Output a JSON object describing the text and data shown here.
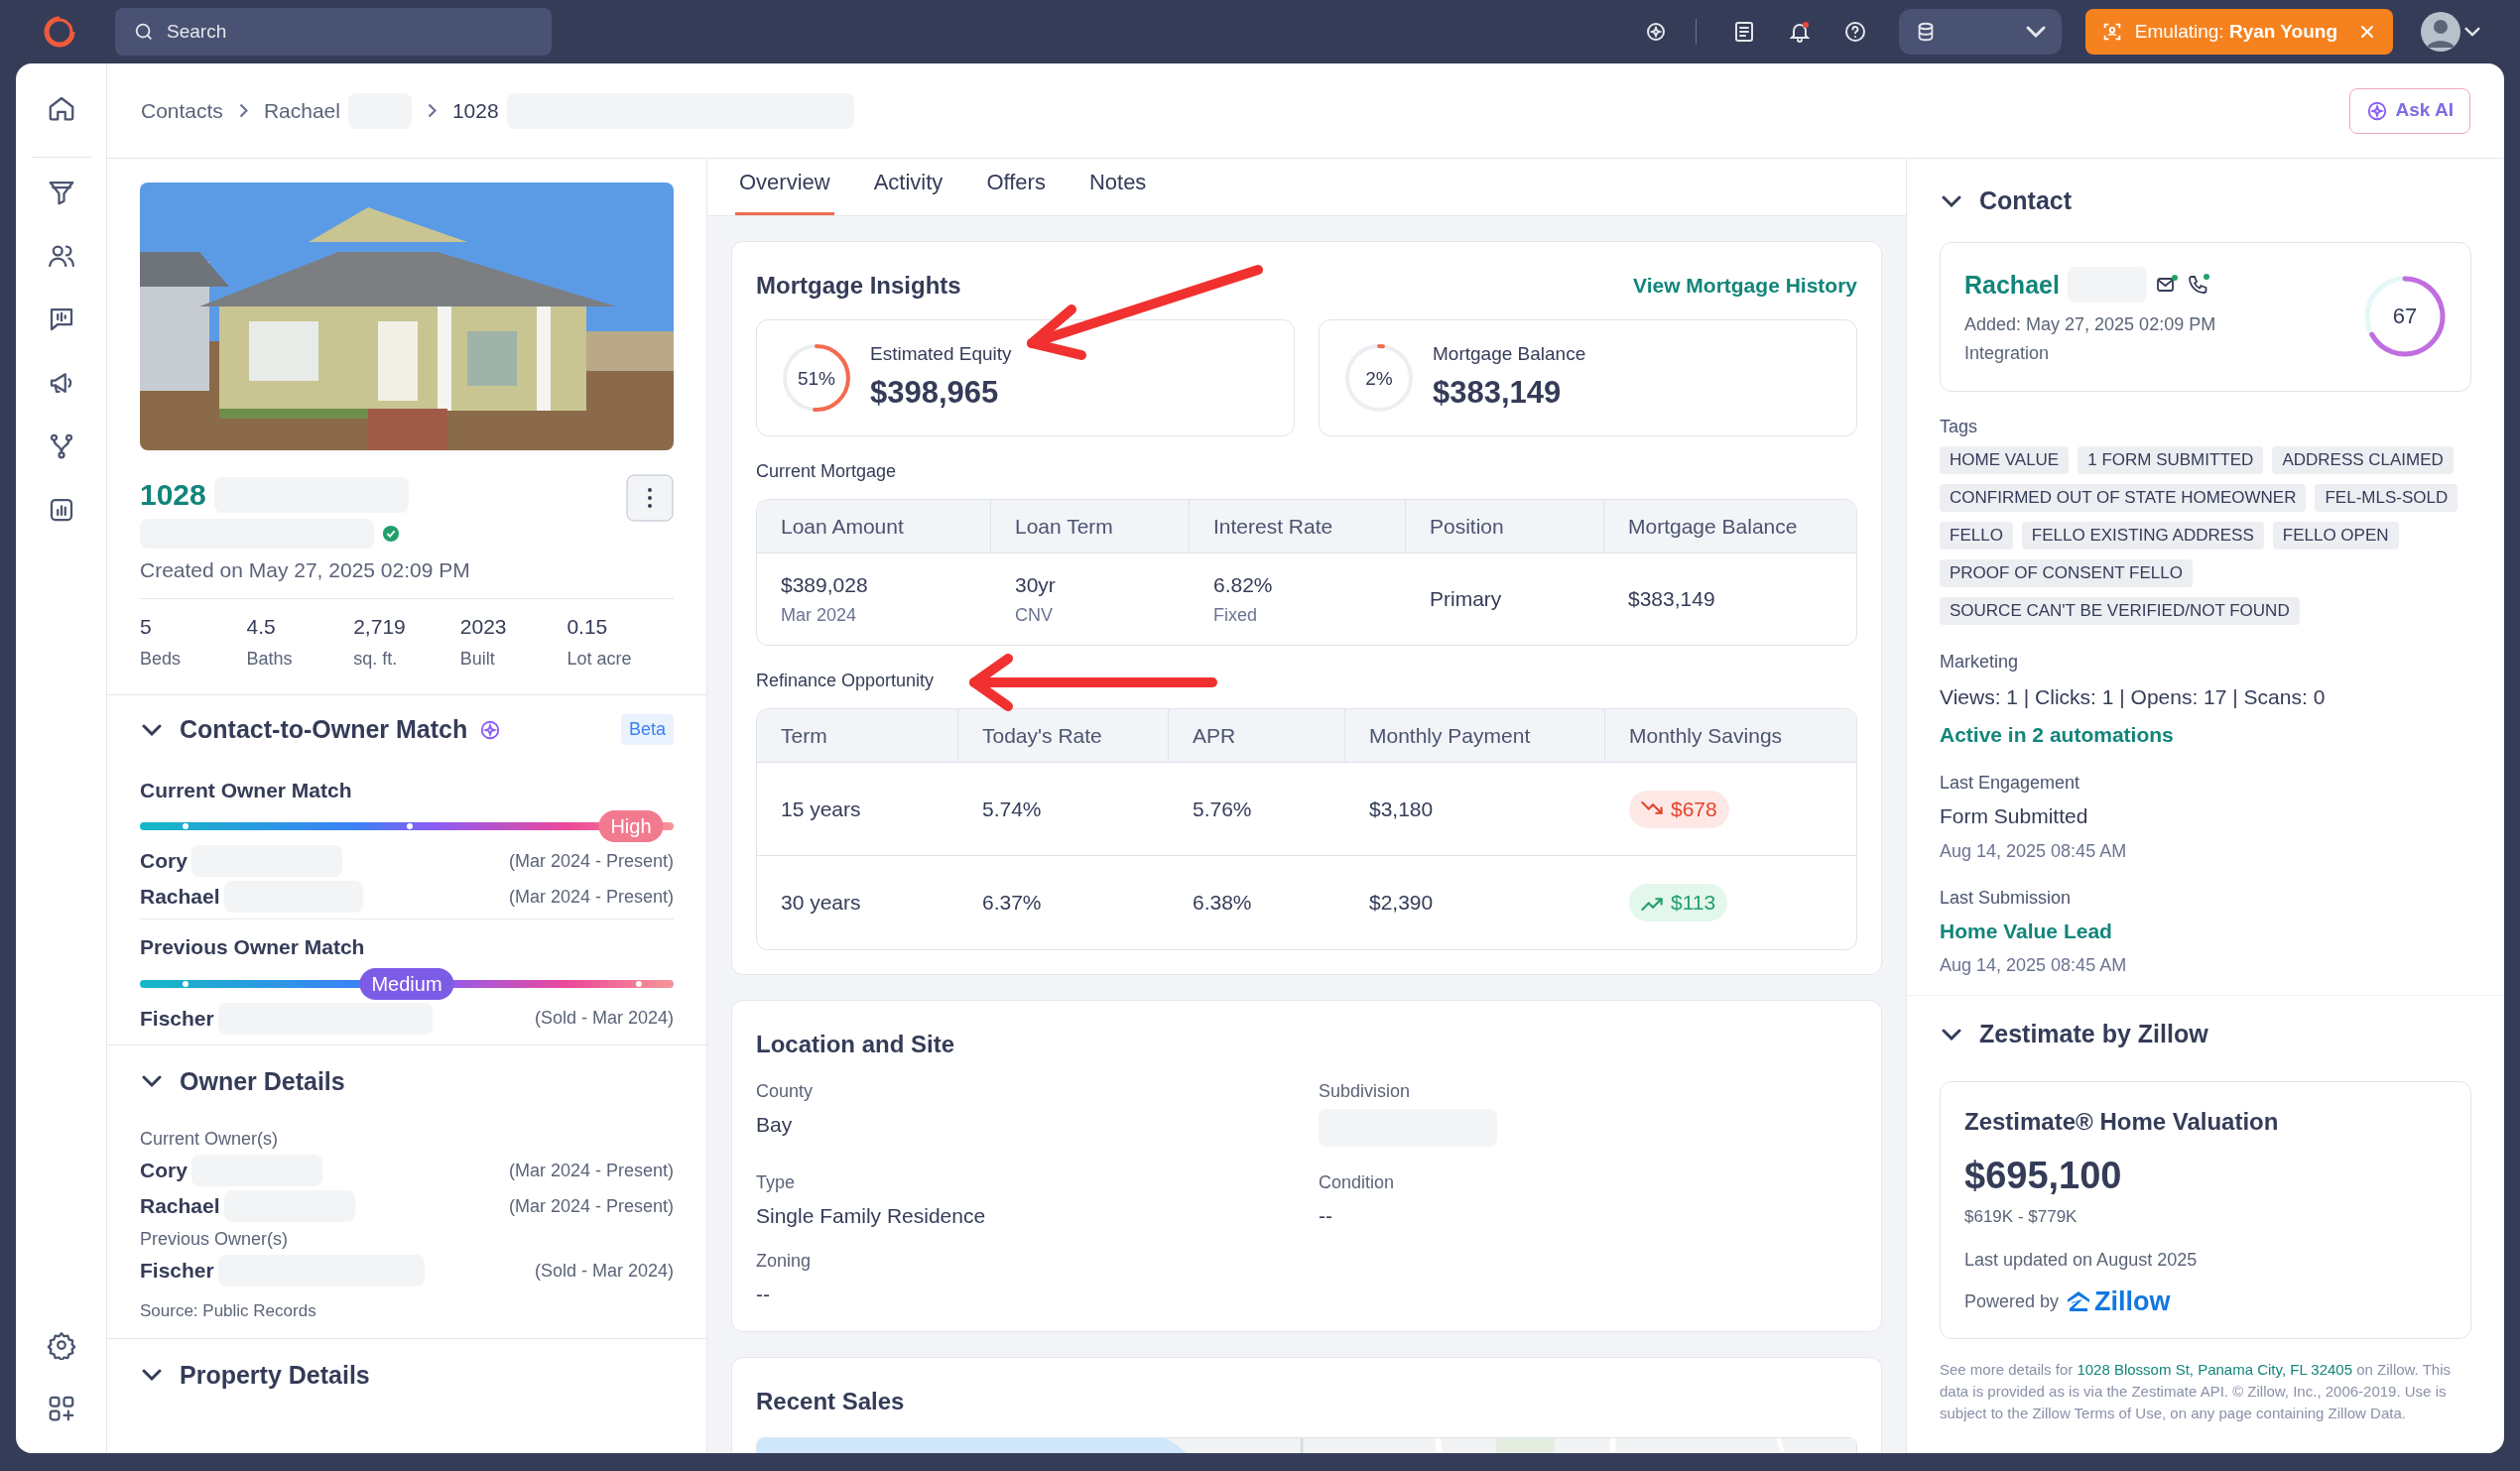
{
  "topbar": {
    "search": {
      "placeholder": "Search"
    },
    "emulating": {
      "label": "Emulating:",
      "name": "Ryan Young"
    }
  },
  "breadcrumb": [
    "Contacts",
    "Rachael",
    "1028"
  ],
  "ask_ai": "Ask AI",
  "property": {
    "title": "1028",
    "created": "Created on May 27, 2025 02:09 PM",
    "stats": [
      {
        "value": "5",
        "label": "Beds"
      },
      {
        "value": "4.5",
        "label": "Baths"
      },
      {
        "value": "2,719",
        "label": "sq. ft."
      },
      {
        "value": "2023",
        "label": "Built"
      },
      {
        "value": "0.15",
        "label": "Lot acre"
      }
    ]
  },
  "owner_match": {
    "title": "Contact-to-Owner Match",
    "badge": "Beta",
    "groups": [
      {
        "title": "Current Owner Match",
        "match": "High",
        "level": 0.92,
        "owners": [
          {
            "name": "Cory",
            "period": "(Mar 2024 - Present)"
          },
          {
            "name": "Rachael",
            "period": "(Mar 2024 - Present)"
          }
        ]
      },
      {
        "title": "Previous Owner Match",
        "match": "Medium",
        "level": 0.5,
        "owners": [
          {
            "name": "Fischer",
            "period": "(Sold - Mar 2024)"
          }
        ]
      }
    ]
  },
  "owner_details": {
    "title": "Owner Details",
    "groups": [
      {
        "label": "Current Owner(s)",
        "owners": [
          {
            "name": "Cory",
            "period": "(Mar 2024 - Present)"
          },
          {
            "name": "Rachael",
            "period": "(Mar 2024 - Present)"
          }
        ]
      },
      {
        "label": "Previous Owner(s)",
        "owners": [
          {
            "name": "Fischer",
            "period": "(Sold - Mar 2024)"
          }
        ]
      }
    ],
    "source": "Source: Public Records"
  },
  "property_details": {
    "title": "Property Details"
  },
  "tabs": [
    {
      "label": "Overview",
      "selected": true
    },
    {
      "label": "Activity",
      "selected": false
    },
    {
      "label": "Offers",
      "selected": false
    },
    {
      "label": "Notes",
      "selected": false
    }
  ],
  "mortgage": {
    "title": "Mortgage Insights",
    "link": "View Mortgage History",
    "gauges": [
      {
        "label": "Estimated Equity",
        "value": "$398,965",
        "percent": "51%"
      },
      {
        "label": "Mortgage Balance",
        "value": "$383,149",
        "percent": "2%"
      }
    ],
    "current": {
      "title": "Current Mortgage",
      "columns": [
        "Loan Amount",
        "Loan Term",
        "Interest Rate",
        "Position",
        "Mortgage Balance"
      ],
      "rows": [
        [
          {
            "main": "$389,028",
            "sub": "Mar 2024"
          },
          {
            "main": "30yr",
            "sub": "CNV"
          },
          {
            "main": "6.82%",
            "sub": "Fixed"
          },
          {
            "main": "Primary"
          },
          {
            "main": "$383,149"
          }
        ]
      ]
    },
    "refinance": {
      "title": "Refinance Opportunity",
      "columns": [
        "Term",
        "Today's Rate",
        "APR",
        "Monthly Payment",
        "Monthly Savings"
      ],
      "rows": [
        {
          "term": "15 years",
          "rate": "5.74%",
          "apr": "5.76%",
          "payment": "$3,180",
          "savings": "$678",
          "kind": "decrease"
        },
        {
          "term": "30 years",
          "rate": "6.37%",
          "apr": "6.38%",
          "payment": "$2,390",
          "savings": "$113",
          "kind": "increase"
        }
      ]
    }
  },
  "location": {
    "title": "Location and Site",
    "fields": [
      {
        "label": "County",
        "kind": "text",
        "value": "Bay"
      },
      {
        "label": "Subdivision",
        "kind": "redacted"
      },
      {
        "label": "Type",
        "kind": "text",
        "value": "Single Family Residence"
      },
      {
        "label": "Condition",
        "kind": "text",
        "value": "--"
      },
      {
        "label": "Zoning",
        "kind": "text",
        "value": "--"
      }
    ]
  },
  "recent_sales": {
    "title": "Recent Sales"
  },
  "contact": {
    "title": "Contact",
    "name": "Rachael",
    "added": "Added: May 27, 2025 02:09 PM",
    "source": "Integration",
    "score": "67",
    "tags_label": "Tags",
    "tags": [
      "HOME VALUE",
      "1 FORM SUBMITTED",
      "ADDRESS CLAIMED",
      "CONFIRMED OUT OF STATE HOMEOWNER",
      "FEL-MLS-SOLD",
      "FELLO",
      "FELLO EXISTING ADDRESS",
      "FELLO OPEN",
      "PROOF OF CONSENT FELLO",
      "SOURCE CAN'T BE VERIFIED/NOT FOUND"
    ],
    "marketing_label": "Marketing",
    "marketing_stats": "Views: 1 | Clicks: 1 | Opens: 17 | Scans: 0",
    "automations": "Active in 2 automations",
    "engagement": {
      "label": "Last Engagement",
      "value": "Form Submitted",
      "date": "Aug 14, 2025 08:45 AM"
    },
    "submission": {
      "label": "Last Submission",
      "value": "Home Value Lead",
      "date": "Aug 14, 2025 08:45 AM"
    }
  },
  "zestimate": {
    "title": "Zestimate by Zillow",
    "card_title": "Zestimate® Home Valuation",
    "value": "$695,100",
    "range": "$619K - $779K",
    "updated": "Last updated on August 2025",
    "powered_by": "Powered by",
    "brand": "Zillow",
    "note_before": "See more details for",
    "note_link": "1028 Blossom St, Panama City, FL 32405",
    "note_after": "on Zillow. This data is provided as is via the Zestimate API. © Zillow, Inc., 2006-2019. Use is subject to the Zillow Terms of Use, on any page containing Zillow Data."
  }
}
